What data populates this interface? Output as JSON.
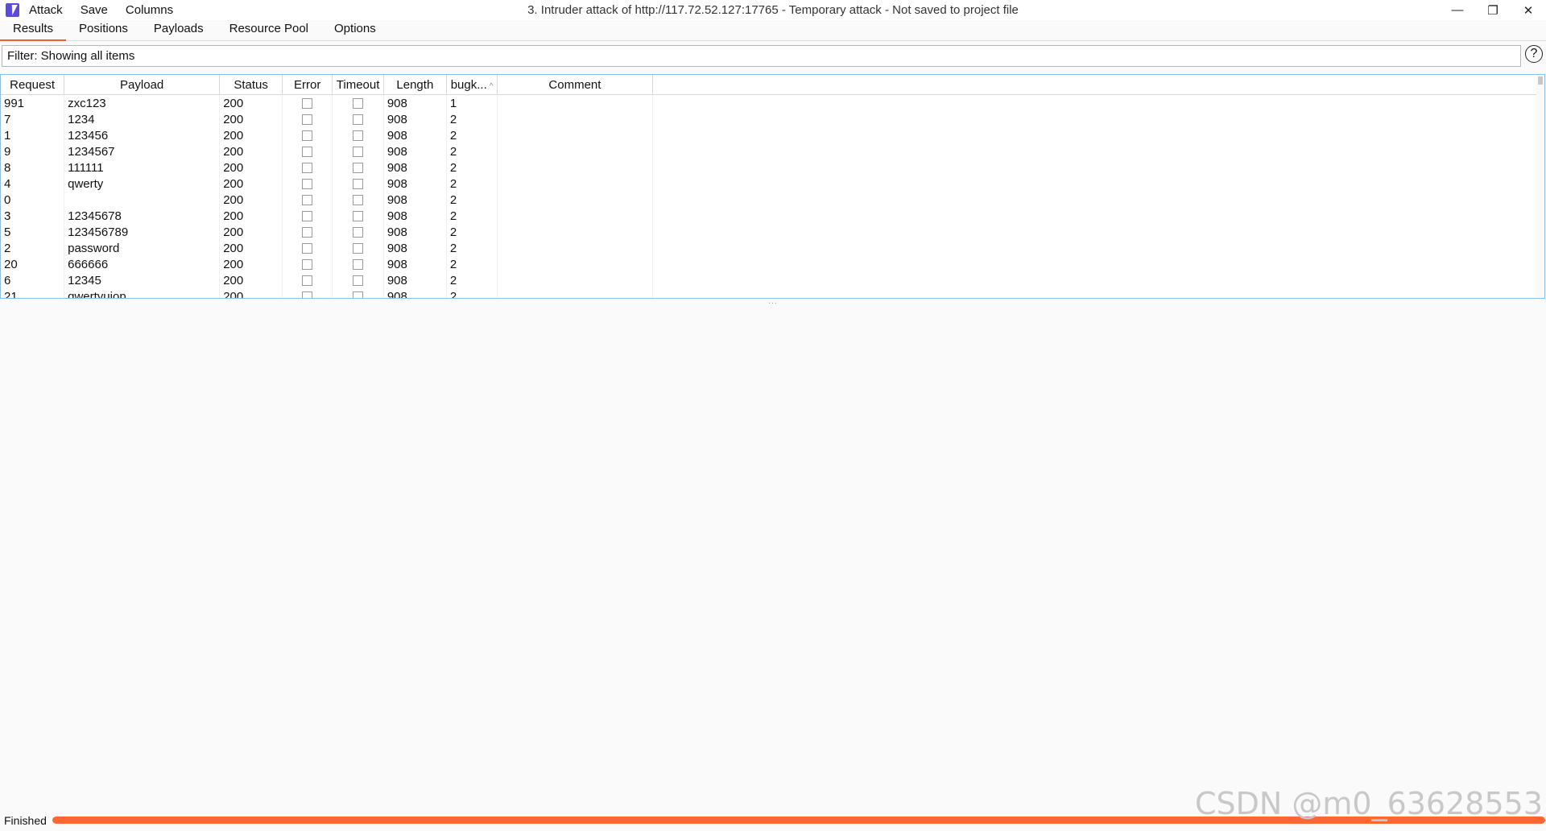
{
  "titlebar": {
    "menus": [
      "Attack",
      "Save",
      "Columns"
    ],
    "title": "3. Intruder attack of http://117.72.52.127:17765 - Temporary attack - Not saved to project file",
    "controls": {
      "minimize": "—",
      "restore": "❐",
      "close": "✕"
    }
  },
  "tabs": [
    "Results",
    "Positions",
    "Payloads",
    "Resource Pool",
    "Options"
  ],
  "active_tab": "Results",
  "filter": {
    "text": "Filter: Showing all items"
  },
  "help": "?",
  "table": {
    "columns": [
      "Request",
      "Payload",
      "Status",
      "Error",
      "Timeout",
      "Length",
      "bugk...",
      "Comment"
    ],
    "sorted_column": "bugk...",
    "rows": [
      {
        "request": "991",
        "payload": "zxc123",
        "status": "200",
        "length": "908",
        "bugk": "1"
      },
      {
        "request": "7",
        "payload": "1234",
        "status": "200",
        "length": "908",
        "bugk": "2"
      },
      {
        "request": "1",
        "payload": "123456",
        "status": "200",
        "length": "908",
        "bugk": "2"
      },
      {
        "request": "9",
        "payload": "1234567",
        "status": "200",
        "length": "908",
        "bugk": "2"
      },
      {
        "request": "8",
        "payload": "111111",
        "status": "200",
        "length": "908",
        "bugk": "2"
      },
      {
        "request": "4",
        "payload": "qwerty",
        "status": "200",
        "length": "908",
        "bugk": "2"
      },
      {
        "request": "0",
        "payload": "",
        "status": "200",
        "length": "908",
        "bugk": "2"
      },
      {
        "request": "3",
        "payload": "12345678",
        "status": "200",
        "length": "908",
        "bugk": "2"
      },
      {
        "request": "5",
        "payload": "123456789",
        "status": "200",
        "length": "908",
        "bugk": "2"
      },
      {
        "request": "2",
        "payload": "password",
        "status": "200",
        "length": "908",
        "bugk": "2"
      },
      {
        "request": "20",
        "payload": "666666",
        "status": "200",
        "length": "908",
        "bugk": "2"
      },
      {
        "request": "6",
        "payload": "12345",
        "status": "200",
        "length": "908",
        "bugk": "2"
      },
      {
        "request": "21",
        "payload": "qwertyuiop",
        "status": "200",
        "length": "908",
        "bugk": "2"
      }
    ]
  },
  "status": {
    "label": "Finished",
    "progress": 1.0,
    "progress_color": "#ff6633"
  },
  "watermark": "CSDN @m0_63628553",
  "colors": {
    "accent": "#e8602c",
    "brand": "#5b4bd8"
  }
}
